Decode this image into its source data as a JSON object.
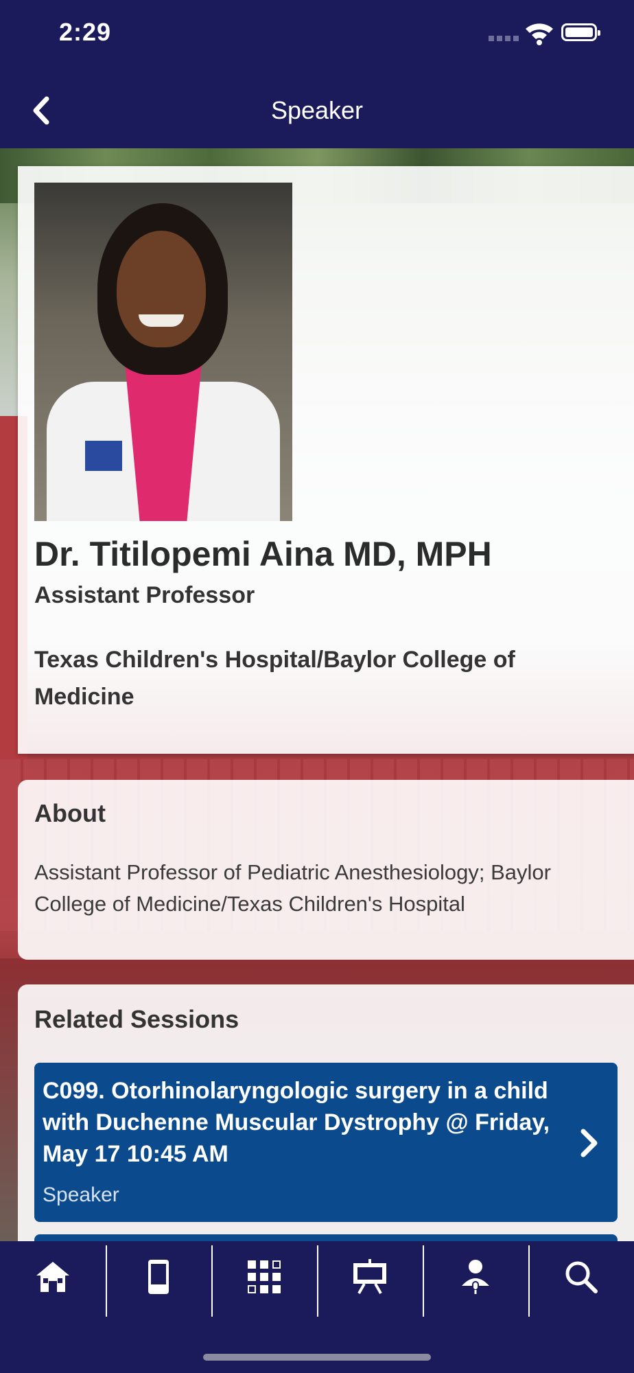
{
  "status_bar": {
    "time": "2:29"
  },
  "nav": {
    "title": "Speaker",
    "back_icon": "chevron-left-icon"
  },
  "speaker": {
    "name": "Dr. Titilopemi Aina MD, MPH",
    "title": "Assistant Professor",
    "organization": "Texas Children's Hospital/Baylor College of Medicine"
  },
  "about": {
    "heading": "About",
    "text": "Assistant Professor of Pediatric Anesthesiology; Baylor College of Medicine/Texas Children's Hospital"
  },
  "related": {
    "heading": "Related Sessions",
    "sessions": [
      {
        "title": "C099. Otorhinolaryngologic surgery in a child with Duchenne Muscular Dystrophy @ Friday, May 17 10:45 AM",
        "role": "Speaker"
      }
    ]
  },
  "tabs": [
    {
      "icon": "home-icon"
    },
    {
      "icon": "mobile-device-icon"
    },
    {
      "icon": "grid-qr-icon"
    },
    {
      "icon": "presentation-board-icon"
    },
    {
      "icon": "speaker-person-icon"
    },
    {
      "icon": "search-icon"
    }
  ],
  "colors": {
    "nav_bg": "#1b1b5b",
    "session_bg": "#0b4a8c"
  }
}
